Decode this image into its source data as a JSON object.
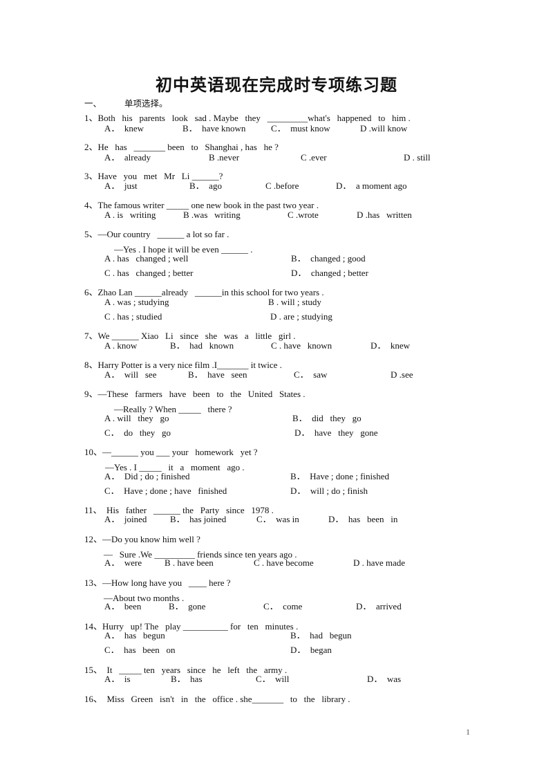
{
  "title": "初中英语现在完成时专项练习题",
  "section": {
    "num": "一、",
    "label": "单项选择。"
  },
  "questions": [
    {
      "q": "1、Both   his   parents   look   sad . Maybe   they   _________what's   happened   to   him .",
      "opts": [
        "A．  knew",
        "B．  have known",
        "C．  must know",
        "D .will know"
      ]
    },
    {
      "q": "2、He   has   _______ been   to   Shanghai , has   he ?",
      "opts": [
        "A．  already",
        "B .never",
        "C .ever",
        "D . still"
      ]
    },
    {
      "q": "3、Have   you   met   Mr   Li ______?",
      "opts": [
        "A．  just",
        "B．  ago",
        "C .before",
        "D．  a moment ago"
      ]
    },
    {
      "q": "4、The famous writer _____ one new book in the past two year .",
      "opts": [
        "A . is   writing",
        "B .was   writing",
        "C .wrote",
        "D .has   written"
      ]
    },
    {
      "q": "5、—Our country   ______ a lot so far .",
      "q2": "—Yes . I hope it will be even ______ .",
      "opts": [
        "A . has   changed ; well",
        "B．  changed ; good",
        "C . has   changed ; better",
        "D．  changed ; better"
      ]
    },
    {
      "q": "6、Zhao Lan ______already   ______in this school for two years .",
      "opts": [
        "A . was ; studying",
        "B . will ; study",
        "C . has ; studied",
        "D . are ; studying"
      ]
    },
    {
      "q": "7、We ______ Xiao   Li   since   she   was   a   little   girl .",
      "opts": [
        "A . know",
        "B．  had   known",
        "C . have   known",
        "D．  knew"
      ]
    },
    {
      "q": "8、Harry Potter is a very nice film .I_______ it twice .",
      "opts": [
        "A．  will   see",
        "B．  have   seen",
        "C．  saw",
        "D .see"
      ]
    },
    {
      "q": "9、—These   farmers   have   been   to   the   United   States .",
      "q2": "—Really ? When _____   there ?",
      "opts": [
        "A . will   they   go",
        "B．  did   they   go",
        "C．  do   they   go",
        "D．  have   they   gone"
      ]
    },
    {
      "q": "10、—______ you ___ your   homework   yet ?",
      "q2": "—Yes . I _____   it   a   moment   ago .",
      "opts": [
        "A．  Did ; do ; finished",
        "B．  Have ; done ; finished",
        "C．  Have ; done ; have   finished",
        "D．  will ; do ; finish"
      ]
    },
    {
      "q": "11、  His   father   ______ the   Party   since   1978 .",
      "opts": [
        "A．  joined",
        "B．  has joined",
        "C．  was in",
        "D．  has   been   in"
      ]
    },
    {
      "q": "12、—Do you know him well ?",
      "q2": "—   Sure .We _________ friends since ten years ago .",
      "opts": [
        "A．  were",
        "B . have been",
        "C . have become",
        "D . have made"
      ]
    },
    {
      "q": "13、—How long have you   ____ here ?",
      "q2": "—About two months .",
      "opts": [
        "A．  been",
        "B．  gone",
        "C．  come",
        "D．  arrived"
      ]
    },
    {
      "q": "14、Hurry   up! The   play __________ for   ten   minutes .",
      "opts": [
        "A．  has   begun",
        "B．  had   begun",
        "C．  has   been   on",
        "D．  began"
      ]
    },
    {
      "q": "15、  It   _____ ten   years   since   he   left   the   army .",
      "opts": [
        "A．  is",
        "B．  has",
        "C．  will",
        "D．  was"
      ]
    },
    {
      "q": "16、  Miss   Green   isn't   in   the   office . she_______   to   the   library ."
    }
  ],
  "page_number": "1"
}
